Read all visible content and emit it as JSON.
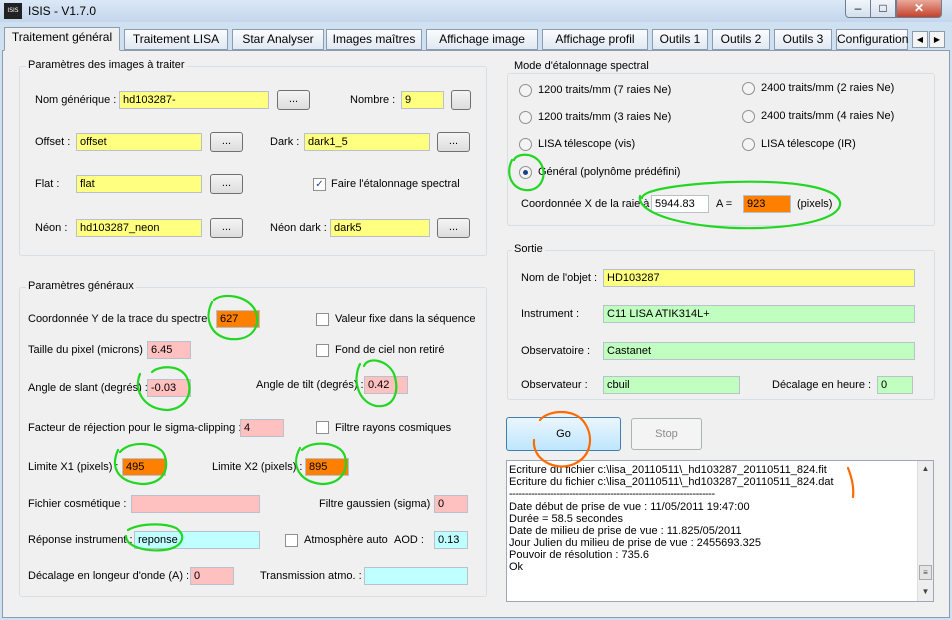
{
  "window": {
    "title": "ISIS - V1.7.0",
    "icon": "isis-icon",
    "icon_text": "ISIS"
  },
  "window_buttons": {
    "minimize": "–",
    "maximize": "□",
    "close": "✕"
  },
  "tabs": [
    "Traitement général",
    "Traitement LISA",
    "Star Analyser",
    "Images maîtres",
    "Affichage image",
    "Affichage profil",
    "Outils 1",
    "Outils 2",
    "Outils 3",
    "Configuration"
  ],
  "tab_scroll": {
    "left": "◀",
    "right": "▶"
  },
  "images_group": {
    "title": "Paramètres des images à traiter",
    "nom_label": "Nom générique :",
    "nom_value": "hd103287-",
    "nombre_label": "Nombre :",
    "nombre_value": "9",
    "offset_label": "Offset :",
    "offset_value": "offset",
    "dark_label": "Dark :",
    "dark_value": "dark1_5",
    "flat_label": "Flat :",
    "flat_value": "flat",
    "etalonnage_label": "Faire l'étalonnage spectral",
    "etalonnage_checked": "✓",
    "neon_label": "Néon :",
    "neon_value": "hd103287_neon",
    "neon_dark_label": "Néon dark :",
    "neon_dark_value": "dark5",
    "browse": "..."
  },
  "general_group": {
    "title": "Paramètres généraux",
    "coordy_label": "Coordonnée Y de la trace du spectre",
    "coordy_value": "627",
    "valeur_fixe_label": "Valeur fixe dans la séquence",
    "pixel_label": "Taille du pixel (microns) :",
    "pixel_value": "6.45",
    "fond_label": "Fond de ciel non retiré",
    "slant_label": "Angle de slant (degrés) :",
    "slant_value": "-0.03",
    "tilt_label": "Angle de tilt (degrés) :",
    "tilt_value": "0.42",
    "rejection_label": "Facteur de réjection pour le sigma-clipping :",
    "rejection_value": "4",
    "cosmiques_label": "Filtre rayons cosmiques",
    "x1_label": "Limite X1 (pixels) :",
    "x1_value": "495",
    "x2_label": "Limite X2 (pixels) :",
    "x2_value": "895",
    "cosmetique_label": "Fichier cosmétique :",
    "cosmetique_value": "",
    "gaussien_label": "Filtre gaussien (sigma) :",
    "gaussien_value": "0",
    "reponse_label": "Réponse instrument :",
    "reponse_value": "reponse",
    "atmosphere_label": "Atmosphère auto",
    "aod_label": "AOD :",
    "aod_value": "0.13",
    "decalage_label": "Décalage en longeur d'onde (A) :",
    "decalage_value": "0",
    "transmission_label": "Transmission atmo. :",
    "transmission_value": ""
  },
  "calibration_group": {
    "title": "Mode d'étalonnage spectral",
    "options": [
      "1200 traits/mm (7 raies Ne)",
      "2400 traits/mm (2 raies Ne)",
      "1200 traits/mm (3 raies Ne)",
      "2400 traits/mm (4 raies Ne)",
      "LISA télescope (vis)",
      "LISA télescope (IR)",
      "Général (polynôme prédéfini)"
    ],
    "selected": "Général (polynôme prédéfini)",
    "coordx_label": "Coordonnée X de la raie à",
    "coordx_value": "5944.83",
    "a_label": "A  =",
    "a_value": "923",
    "pixels_label": "(pixels)"
  },
  "sortie_group": {
    "title": "Sortie",
    "objet_label": "Nom de l'objet :",
    "objet_value": "HD103287",
    "instrument_label": "Instrument :",
    "instrument_value": "C11 LISA ATIK314L+",
    "observatoire_label": "Observatoire :",
    "observatoire_value": "Castanet",
    "observateur_label": "Observateur :",
    "observateur_value": "cbuil",
    "decalage_heure_label": "Décalage en heure :",
    "decalage_heure_value": "0"
  },
  "actions": {
    "go": "Go",
    "stop": "Stop"
  },
  "log": [
    "Ecriture du fichier c:\\lisa_20110511\\_hd103287_20110511_824.fit",
    "Ecriture du fichier c:\\lisa_20110511\\_hd103287_20110511_824.dat",
    "-----------------------------------------------------------------",
    "Date début de prise de vue : 11/05/2011 19:47:00",
    "Durée = 58.5 secondes",
    "Date de milieu de prise de vue : 11.825/05/2011",
    "Jour Julien du milieu de prise de vue : 2455693.325",
    "Pouvoir de résolution : 735.6",
    "Ok"
  ],
  "log_scroll": {
    "up": "▲",
    "down": "▼",
    "thumb": "≡"
  },
  "colors": {
    "annotation_green": "#22d622",
    "annotation_orange": "#ff6a00"
  }
}
